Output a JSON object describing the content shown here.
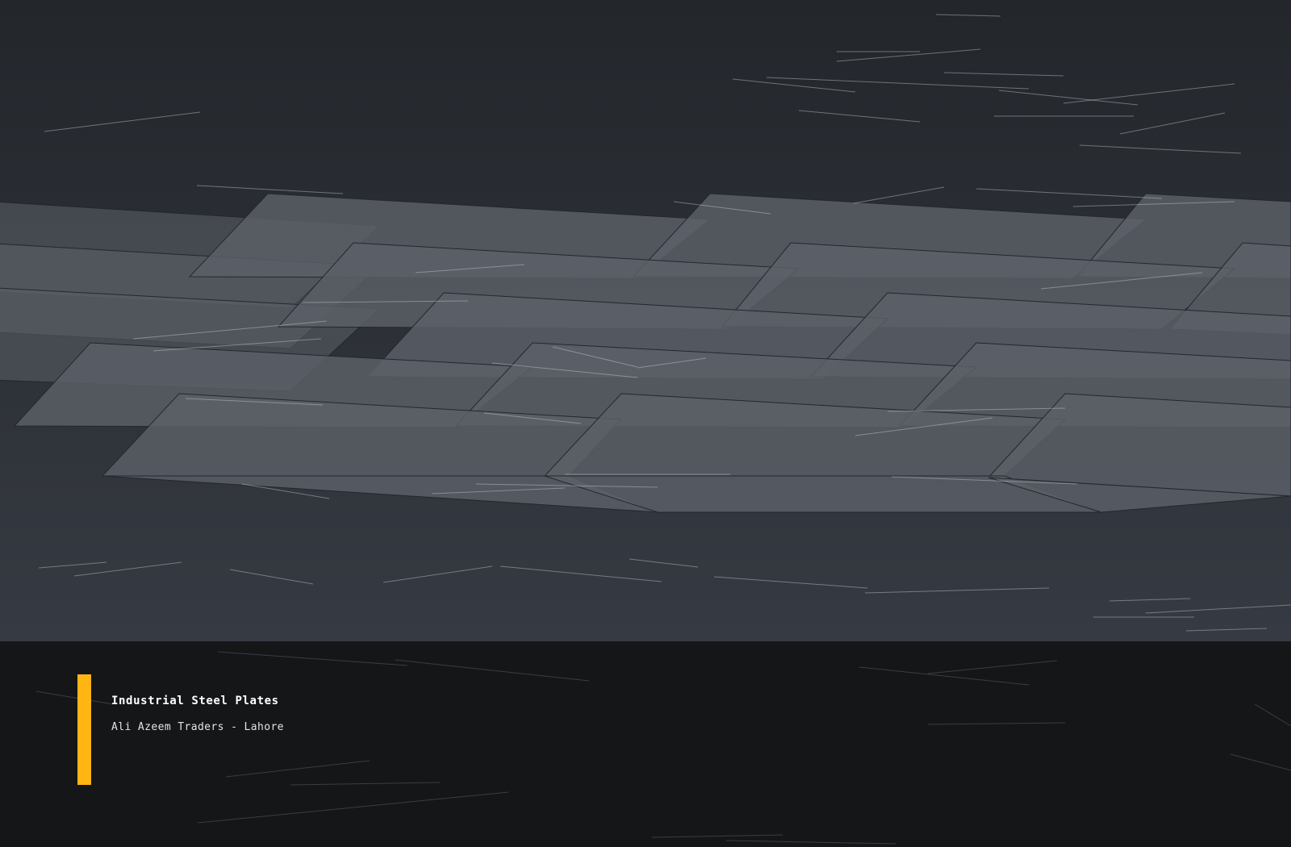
{
  "caption": {
    "title": "Industrial Steel Plates",
    "subtitle": "Ali Azeem Traders - Lahore"
  },
  "colors": {
    "background_top": "#23262b",
    "background_bottom": "#363a42",
    "plate_fill": "#5b6068",
    "plate_edge": "#24272c",
    "footer_background": "#151618",
    "accent": "#ffb612"
  },
  "scene": {
    "subject": "stacked steel plates"
  }
}
